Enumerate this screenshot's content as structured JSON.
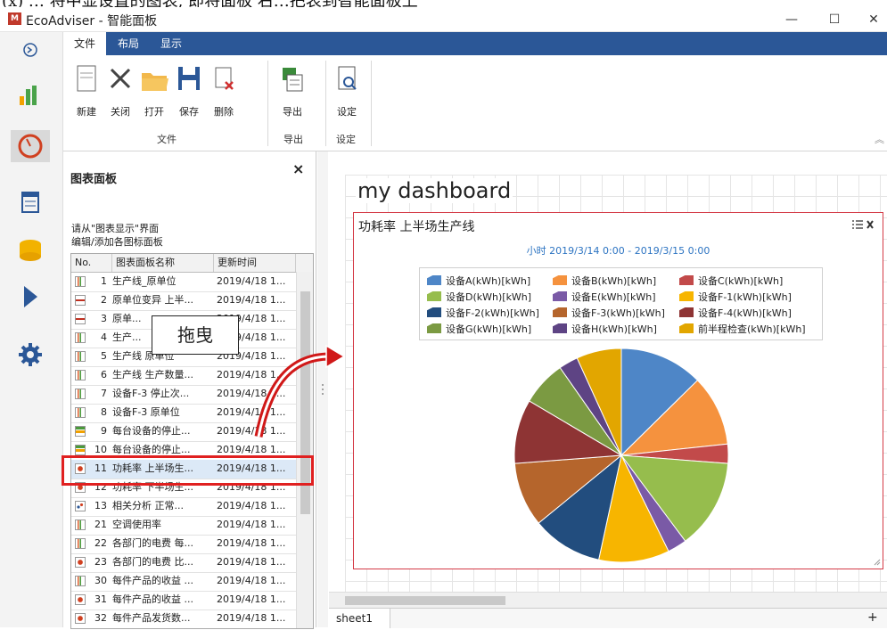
{
  "top_caption": "(x) … 将中显设置的图表, 即将面板  右…把表到智能面板上",
  "window": {
    "logo_text": "M",
    "title": "EcoAdviser - 智能面板",
    "minimize": "—",
    "maximize": "☐",
    "close": "✕"
  },
  "ribbon": {
    "tabs": [
      {
        "label": "文件",
        "active": true
      },
      {
        "label": "布局",
        "active": false
      },
      {
        "label": "显示",
        "active": false
      }
    ],
    "buttons": [
      {
        "label": "新建",
        "icon": "new-file-icon"
      },
      {
        "label": "关闭",
        "icon": "close-x-icon"
      },
      {
        "label": "打开",
        "icon": "open-folder-icon"
      },
      {
        "label": "保存",
        "icon": "save-disk-icon"
      },
      {
        "label": "删除",
        "icon": "delete-file-icon"
      },
      {
        "label": "导出",
        "icon": "export-icon"
      },
      {
        "label": "设定",
        "icon": "settings-doc-icon"
      }
    ],
    "groups": [
      "文件",
      "导出",
      "设定"
    ],
    "collapse": "︽"
  },
  "panel": {
    "title": "图表面板",
    "close": "×",
    "note_line1": "请从\"图表显示\"界面",
    "note_line2": "编辑/添加各图标面板",
    "columns": [
      "No.",
      "图表面板名称",
      "更新时间"
    ],
    "rows": [
      {
        "no": "1",
        "name": "生产线_原单位",
        "time": "2019/4/18 1...",
        "icon": "bar-chart-icon"
      },
      {
        "no": "2",
        "name": "原单位变异 上半...",
        "time": "2019/4/18 1...",
        "icon": "phi-chart-icon"
      },
      {
        "no": "3",
        "name": "原单...",
        "time": "2019/4/18 1...",
        "icon": "phi-chart-icon"
      },
      {
        "no": "4",
        "name": "生产...",
        "time": "2019/4/18 1...",
        "icon": "bar-chart-icon"
      },
      {
        "no": "5",
        "name": "生产线 原单位",
        "time": "2019/4/18 1...",
        "icon": "bar-chart-icon"
      },
      {
        "no": "6",
        "name": "生产线 生产数量...",
        "time": "2019/4/18 1...",
        "icon": "bar-chart-icon"
      },
      {
        "no": "7",
        "name": "设备F-3 停止次...",
        "time": "2019/4/18 1...",
        "icon": "bar-chart-icon"
      },
      {
        "no": "8",
        "name": "设备F-3 原单位",
        "time": "2019/4/18 1...",
        "icon": "bar-chart-icon"
      },
      {
        "no": "9",
        "name": "每台设备的停止...",
        "time": "2019/4/18 1...",
        "icon": "hbar-chart-icon"
      },
      {
        "no": "10",
        "name": "每台设备的停止...",
        "time": "2019/4/18 1...",
        "icon": "hbar-chart-icon"
      },
      {
        "no": "11",
        "name": "功耗率 上半场生...",
        "time": "2019/4/18 1...",
        "icon": "gauge-icon",
        "selected": true
      },
      {
        "no": "12",
        "name": "功耗率 下半场生...",
        "time": "2019/4/18 1...",
        "icon": "gauge-icon"
      },
      {
        "no": "13",
        "name": "相关分析  正常...",
        "time": "2019/4/18 1...",
        "icon": "scatter-icon"
      },
      {
        "no": "21",
        "name": "空调使用率",
        "time": "2019/4/18 1...",
        "icon": "bar-chart-icon"
      },
      {
        "no": "22",
        "name": "各部门的电费 每...",
        "time": "2019/4/18 1...",
        "icon": "bar-chart-icon"
      },
      {
        "no": "23",
        "name": "各部门的电费 比...",
        "time": "2019/4/18 1...",
        "icon": "gauge-icon"
      },
      {
        "no": "30",
        "name": "每件产品的收益 ...",
        "time": "2019/4/18 1...",
        "icon": "bar-chart-icon"
      },
      {
        "no": "31",
        "name": "每件产品的收益 ...",
        "time": "2019/4/18 1...",
        "icon": "gauge-icon"
      },
      {
        "no": "32",
        "name": "每件产品发货数...",
        "time": "2019/4/18 1...",
        "icon": "gauge-icon"
      }
    ]
  },
  "overlay": {
    "drag_label": "拖曳"
  },
  "dashboard": {
    "title": "my dashboard",
    "sheet_tab": "sheet1",
    "add_sheet": "+",
    "chart_title": "功耗率 上半场生产线",
    "chart_subtitle": "小时 2019/3/14 0:00 - 2019/3/15 0:00",
    "colors": {
      "accent": "#2b5797",
      "highlight": "#e02020",
      "panel_border": "#d43a46",
      "subtitle": "#2d74c2"
    }
  },
  "chart_data": {
    "type": "pie",
    "title": "功耗率 上半场生产线",
    "subtitle": "小时 2019/3/14 0:00 - 2019/3/15 0:00",
    "legend_position": "top",
    "labels": [
      "设备A(kWh)[kWh]",
      "设备B(kWh)[kWh]",
      "设备C(kWh)[kWh]",
      "设备D(kWh)[kWh]",
      "设备E(kWh)[kWh]",
      "设备F-1(kWh)[kWh]",
      "设备F-2(kWh)[kWh]",
      "设备F-3(kWh)[kWh]",
      "设备F-4(kWh)[kWh]",
      "设备G(kWh)[kWh]",
      "设备H(kWh)[kWh]",
      "前半程检查(kWh)[kWh]"
    ],
    "values": [
      13,
      11,
      3,
      14,
      3,
      11,
      11,
      10,
      10,
      7,
      3,
      7
    ],
    "colors": [
      "#4e86c7",
      "#f5923e",
      "#c24a4a",
      "#96bd4d",
      "#7a5aa6",
      "#f7b500",
      "#224d7e",
      "#b5652c",
      "#8e3434",
      "#7b9a42",
      "#5e4484",
      "#e2a600"
    ]
  }
}
